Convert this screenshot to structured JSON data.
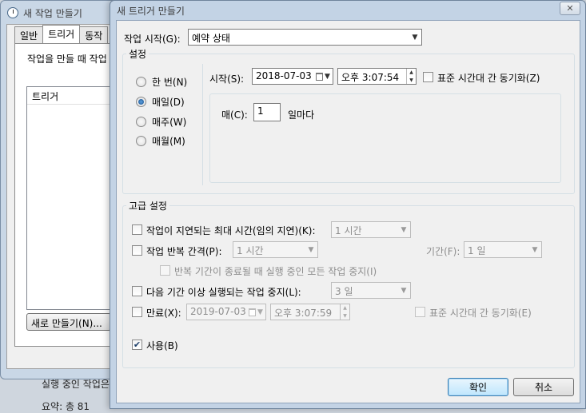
{
  "background_window": {
    "title": "새 작업 만들기",
    "tabs": [
      "일반",
      "트리거",
      "동작"
    ],
    "description": "작업을 만들 때 작업",
    "list_header": "트리거",
    "new_button": "새로 만들기(N)...",
    "bottom_text_1": "실행 중인 작업은",
    "bottom_text_2": "요약: 총 81"
  },
  "dialog": {
    "title": "새 트리거 만들기",
    "close_glyph": "✕",
    "start_task": {
      "label": "작업 시작(G):",
      "value": "예약 상태"
    },
    "settings": {
      "group_label": "설정",
      "schedule_options": [
        {
          "label": "한 번(N)",
          "checked": false
        },
        {
          "label": "매일(D)",
          "checked": true
        },
        {
          "label": "매주(W)",
          "checked": false
        },
        {
          "label": "매월(M)",
          "checked": false
        }
      ],
      "start_label": "시작(S):",
      "start_date": "2018-07-03",
      "start_time": "오후   3:07:54",
      "sync_tz_label": "표준 시간대 간 동기화(Z)",
      "recur_label": "매(C):",
      "recur_value": "1",
      "recur_unit": "일마다"
    },
    "advanced": {
      "group_label": "고급 설정",
      "delay_label": "작업이 지연되는 최대 시간(임의 지연)(K):",
      "delay_value": "1 시간",
      "repeat_label": "작업 반복 간격(P):",
      "repeat_value": "1 시간",
      "duration_label": "기간(F):",
      "duration_value": "1 일",
      "stop_all_label": "반복 기간이 종료될 때 실행 중인 모든 작업 중지(I)",
      "stop_longer_label": "다음 기간 이상 실행되는 작업 중지(L):",
      "stop_longer_value": "3 일",
      "expire_label": "만료(X):",
      "expire_date": "2019-07-03",
      "expire_time": "오후    3:07:59",
      "expire_sync_label": "표준 시간대 간 동기화(E)",
      "enabled_label": "사용(B)",
      "enabled_checked": true
    },
    "ok_button": "확인",
    "cancel_button": "취소"
  }
}
